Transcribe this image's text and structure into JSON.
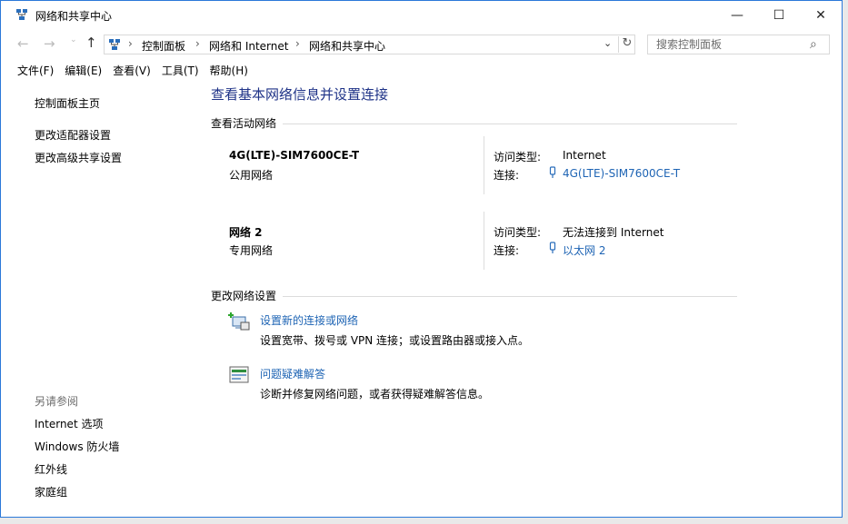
{
  "window": {
    "title": "网络和共享中心",
    "controls": {
      "minimize": "—",
      "maximize": "☐",
      "close": "✕"
    }
  },
  "address": {
    "crumbs": [
      "控制面板",
      "网络和 Internet",
      "网络和共享中心"
    ],
    "search_placeholder": "搜索控制面板"
  },
  "menu": [
    "文件(F)",
    "编辑(E)",
    "查看(V)",
    "工具(T)",
    "帮助(H)"
  ],
  "sidebar": {
    "home": "控制面板主页",
    "links": [
      "更改适配器设置",
      "更改高级共享设置"
    ],
    "see_also_label": "另请参阅",
    "see_also": [
      "Internet 选项",
      "Windows 防火墙",
      "红外线",
      "家庭组"
    ]
  },
  "main": {
    "title": "查看基本网络信息并设置连接",
    "active_networks_header": "查看活动网络",
    "networks": [
      {
        "name": "4G(LTE)-SIM7600CE-T",
        "type": "公用网络",
        "access_label": "访问类型:",
        "access_value": "Internet",
        "conn_label": "连接:",
        "conn_value": "4G(LTE)-SIM7600CE-T"
      },
      {
        "name": "网络  2",
        "type": "专用网络",
        "access_label": "访问类型:",
        "access_value": "无法连接到 Internet",
        "conn_label": "连接:",
        "conn_value": "以太网 2"
      }
    ],
    "change_header": "更改网络设置",
    "tasks": [
      {
        "link": "设置新的连接或网络",
        "desc": "设置宽带、拨号或 VPN 连接；或设置路由器或接入点。"
      },
      {
        "link": "问题疑难解答",
        "desc": "诊断并修复网络问题，或者获得疑难解答信息。"
      }
    ]
  },
  "colors": {
    "link": "#1e64b4",
    "title": "#1e3287",
    "border": "#2b79d9"
  }
}
